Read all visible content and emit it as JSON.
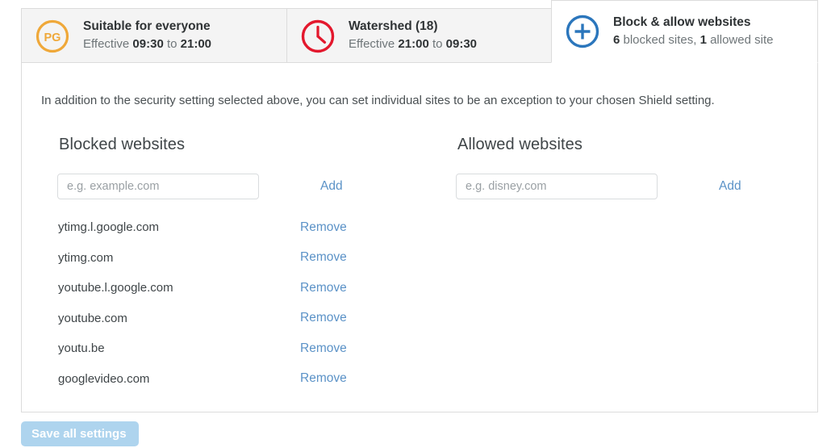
{
  "tabs": [
    {
      "icon": "pg-rating-icon",
      "icon_label": "PG",
      "title": "Suitable for everyone",
      "sub_prefix": "Effective ",
      "sub_start": "09:30",
      "sub_mid": " to ",
      "sub_end": "21:00",
      "active": false,
      "color": "#efa839"
    },
    {
      "icon": "clock-icon",
      "icon_label": "",
      "title": "Watershed (18)",
      "sub_prefix": "Effective ",
      "sub_start": "21:00",
      "sub_mid": " to ",
      "sub_end": "09:30",
      "active": false,
      "color": "#e3182d"
    },
    {
      "icon": "plus-circle-icon",
      "icon_label": "",
      "title": "Block & allow websites",
      "sub_prefix": "",
      "sub_start": "6",
      "sub_mid": " blocked sites, ",
      "sub_end": "1",
      "sub_tail": " allowed site",
      "active": true,
      "color": "#2b76bc"
    }
  ],
  "panel": {
    "intro": "In addition to the security setting selected above, you can set individual sites to be an exception to your chosen Shield setting.",
    "blocked": {
      "heading": "Blocked websites",
      "input_value": "",
      "input_placeholder": "e.g. example.com",
      "add_label": "Add",
      "remove_label": "Remove",
      "sites": [
        "ytimg.l.google.com",
        "ytimg.com",
        "youtube.l.google.com",
        "youtube.com",
        "youtu.be",
        "googlevideo.com"
      ]
    },
    "allowed": {
      "heading": "Allowed websites",
      "input_value": "",
      "input_placeholder": "e.g. disney.com",
      "add_label": "Add",
      "remove_label": "Remove",
      "sites": []
    }
  },
  "footer": {
    "save_label": "Save all settings"
  },
  "colors": {
    "link": "#5b92c7",
    "save_bg": "#aed4ee",
    "tab_inactive_bg": "#f4f4f4",
    "border": "#dcdcdc"
  }
}
